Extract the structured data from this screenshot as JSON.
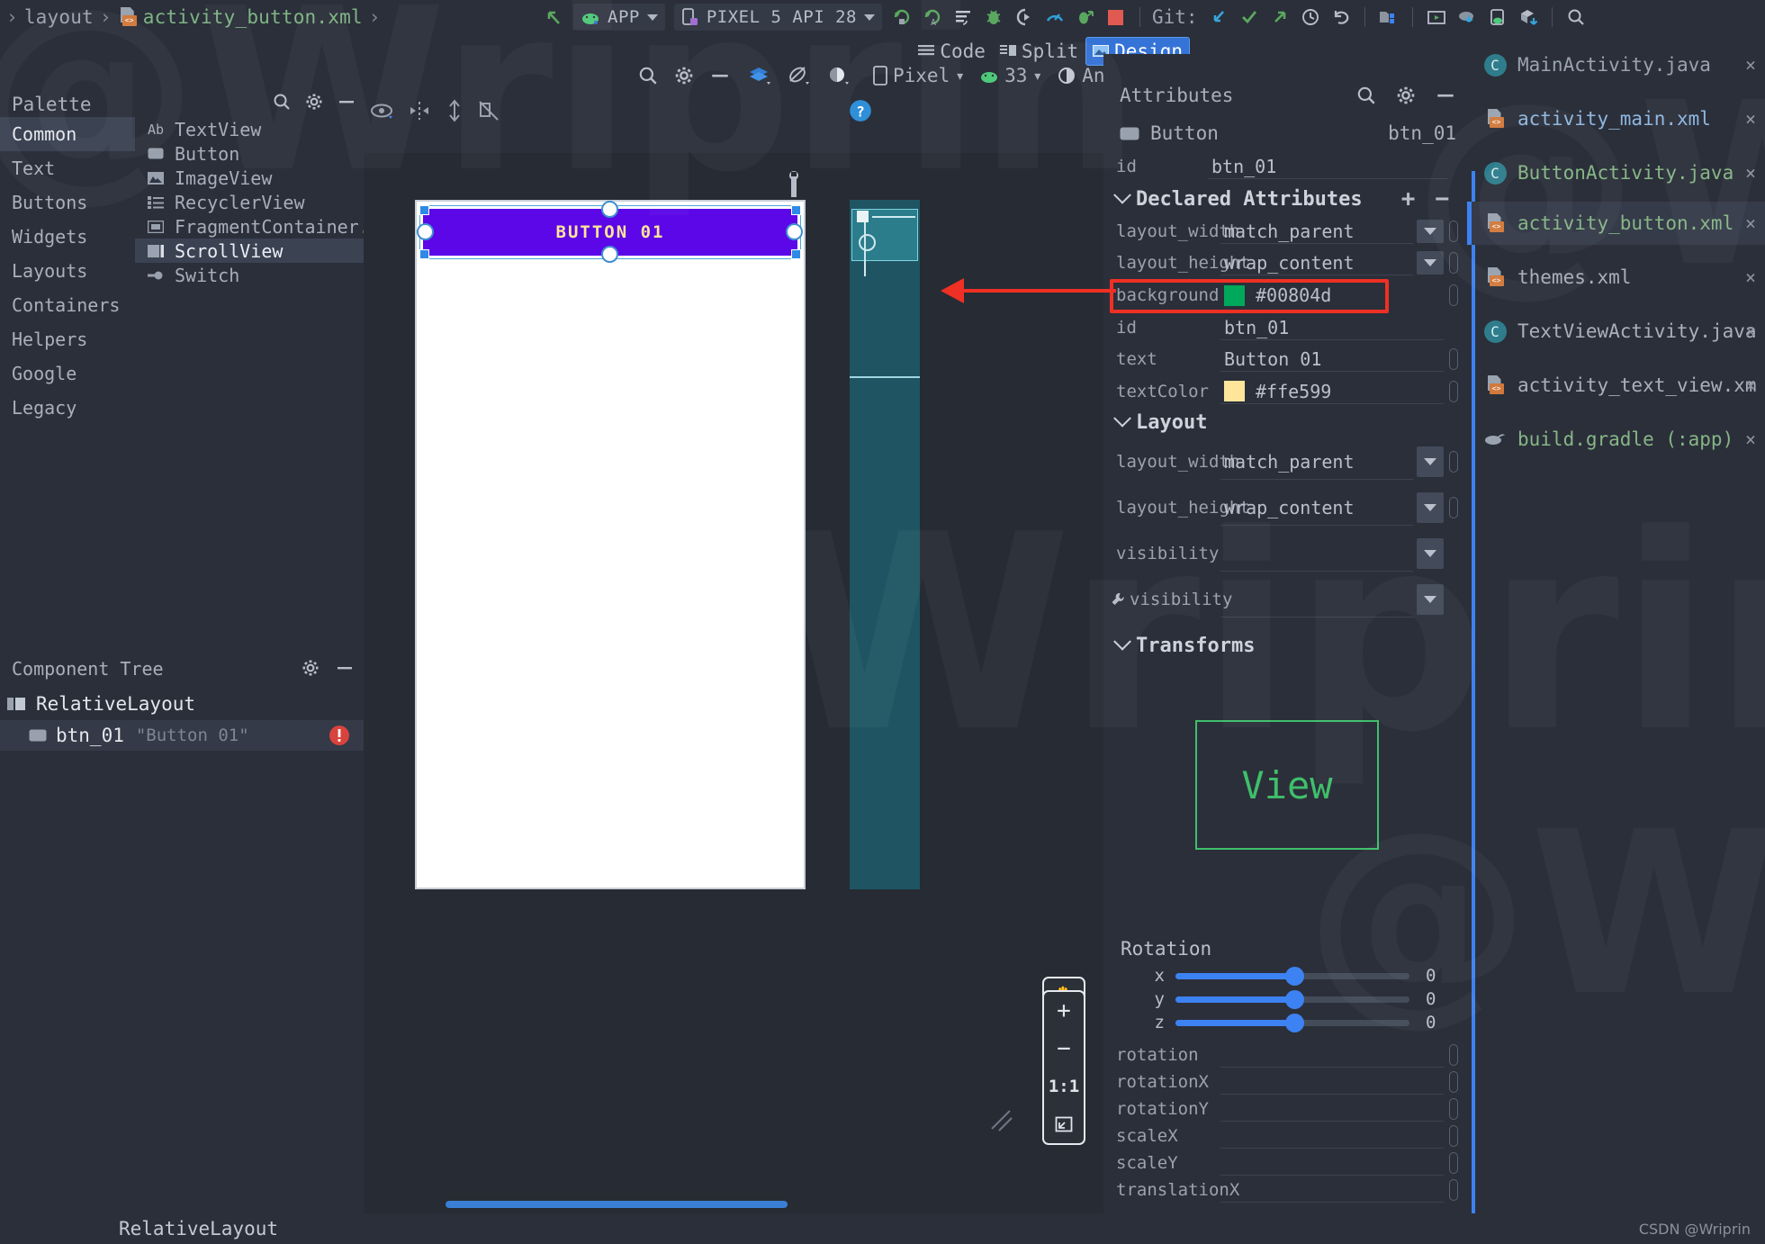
{
  "breadcrumb": {
    "sep": "›",
    "items": [
      {
        "label": "layout",
        "type": "folder"
      },
      {
        "label": "activity_button.xml",
        "type": "xml"
      }
    ]
  },
  "toolbar": {
    "back_icon": "arrow-back-icon",
    "module_selector": {
      "label": "APP",
      "icon": "android-icon"
    },
    "device_selector": {
      "label": "PIXEL 5 API 28",
      "icon": "device-icon"
    },
    "icons": [
      "run-icon",
      "apply-changes-icon",
      "apply-code-changes-icon",
      "run-with-coverage-icon",
      "debug-icon",
      "profile-icon",
      "stop-icon"
    ],
    "git_label": "Git:",
    "git_icons": [
      "update-project-icon",
      "commit-icon",
      "push-icon",
      "history-icon",
      "undo-icon"
    ],
    "right_icons": [
      "project-structure-icon",
      "avd-manager-icon",
      "sdk-manager-icon",
      "device-manager-icon",
      "build-icon",
      "search-icon"
    ]
  },
  "mode_bar": {
    "modes": [
      {
        "label": "Code",
        "icon": "code-icon",
        "active": false
      },
      {
        "label": "Split",
        "icon": "split-icon",
        "active": false
      },
      {
        "label": "Design",
        "icon": "design-icon",
        "active": true
      }
    ]
  },
  "palette": {
    "title": "Palette",
    "header_icons": [
      "search-icon",
      "gear-icon",
      "minimize-icon"
    ],
    "categories": [
      {
        "label": "Common",
        "selected": true
      },
      {
        "label": "Text",
        "selected": false
      },
      {
        "label": "Buttons",
        "selected": false
      },
      {
        "label": "Widgets",
        "selected": false
      },
      {
        "label": "Layouts",
        "selected": false
      },
      {
        "label": "Containers",
        "selected": false
      },
      {
        "label": "Helpers",
        "selected": false
      },
      {
        "label": "Google",
        "selected": false
      },
      {
        "label": "Legacy",
        "selected": false
      }
    ],
    "items": [
      {
        "label": "TextView",
        "icon": "ab-text-icon",
        "selected": false
      },
      {
        "label": "Button",
        "icon": "button-icon",
        "selected": false
      },
      {
        "label": "ImageView",
        "icon": "image-icon",
        "selected": false
      },
      {
        "label": "RecyclerView",
        "icon": "list-icon",
        "selected": false
      },
      {
        "label": "FragmentContainer...",
        "icon": "fragment-icon",
        "selected": false
      },
      {
        "label": "ScrollView",
        "icon": "scrollview-icon",
        "selected": true
      },
      {
        "label": "Switch",
        "icon": "switch-icon",
        "selected": false
      }
    ]
  },
  "component_tree": {
    "title": "Component Tree",
    "header_icons": [
      "gear-icon",
      "minimize-icon"
    ],
    "rows": [
      {
        "name": "RelativeLayout",
        "value": "",
        "icon": "relativelayout-icon",
        "selected": false,
        "error": false
      },
      {
        "name": "btn_01",
        "value": "\"Button 01\"",
        "icon": "button-icon",
        "selected": true,
        "error": true
      }
    ]
  },
  "design_toolbar": {
    "left_icons": [
      "search-icon",
      "gear-icon",
      "minimize-icon"
    ],
    "view_mode_icon": "design-surface-icon",
    "orientation_icon": "rotate-icon",
    "theme_icon": "night-mode-icon",
    "device": {
      "label": "Pixel",
      "icon": "phone-icon"
    },
    "api": {
      "label": "33",
      "icon": "android-icon"
    },
    "theme": {
      "label": "AndroidWalkthrough",
      "icon": "theme-icon"
    },
    "overflow": "»",
    "error_badge": "!",
    "help_badge": "?",
    "row2_icons": [
      "eye-icon",
      "align-horizontal-icon",
      "expand-vertical-icon",
      "no-constraints-icon"
    ]
  },
  "canvas": {
    "button_text": "BUTTON 01",
    "button_background": "#5c07e8",
    "button_text_color": "#ffe599",
    "wrench_icon": "wrench-icon",
    "zoom_controls": {
      "pan_icon": "pan-hand-icon",
      "zoom_in": "+",
      "zoom_out": "−",
      "zoom_actual": "1:1",
      "zoom_fit": "fit-screen-icon"
    }
  },
  "attributes": {
    "title": "Attributes",
    "header_icons": [
      "search-icon",
      "gear-icon",
      "minimize-icon"
    ],
    "selected_component": "Button",
    "selected_id": "btn_01",
    "id_row": {
      "key": "id",
      "value": "btn_01"
    },
    "sections": [
      {
        "title": "Declared Attributes",
        "has_add_remove": true,
        "add_label": "+",
        "remove_label": "−",
        "rows": [
          {
            "key": "layout_width",
            "value": "match_parent",
            "dropdown": true
          },
          {
            "key": "layout_height",
            "value": "wrap_content",
            "dropdown": true
          },
          {
            "key": "background",
            "value": "#00804d",
            "swatch": "#00a85c",
            "highlighted": true
          },
          {
            "key": "id",
            "value": "btn_01"
          },
          {
            "key": "text",
            "value": "Button 01"
          },
          {
            "key": "textColor",
            "value": "#ffe599",
            "swatch": "#ffe599"
          }
        ]
      },
      {
        "title": "Layout",
        "has_add_remove": false,
        "rows": [
          {
            "key": "layout_width",
            "value": "match_parent",
            "dropdown": true
          },
          {
            "key": "layout_height",
            "value": "wrap_content",
            "dropdown": true
          },
          {
            "key": "visibility",
            "value": "",
            "dropdown": true
          },
          {
            "key": "visibility",
            "value": "",
            "dropdown": true,
            "wrench": true
          }
        ]
      },
      {
        "title": "Transforms",
        "has_add_remove": false,
        "rows": []
      }
    ],
    "view_preview_label": "View",
    "view_preview_color": "#3fbf6a",
    "rotation": {
      "title": "Rotation",
      "axes": [
        {
          "label": "x",
          "value": "0"
        },
        {
          "label": "y",
          "value": "0"
        },
        {
          "label": "z",
          "value": "0"
        }
      ]
    },
    "transform_rows": [
      {
        "key": "rotation",
        "value": ""
      },
      {
        "key": "rotationX",
        "value": ""
      },
      {
        "key": "rotationY",
        "value": ""
      },
      {
        "key": "scaleX",
        "value": ""
      },
      {
        "key": "scaleY",
        "value": ""
      },
      {
        "key": "translationX",
        "value": ""
      }
    ]
  },
  "files": [
    {
      "name": "MainActivity.java",
      "icon": "java-class-icon",
      "style": "java",
      "selected": false
    },
    {
      "name": "activity_main.xml",
      "icon": "xml-layout-icon",
      "style": "xml",
      "selected": false
    },
    {
      "name": "ButtonActivity.java",
      "icon": "java-class-icon",
      "style": "green",
      "selected": false
    },
    {
      "name": "activity_button.xml",
      "icon": "xml-layout-icon",
      "style": "green",
      "selected": true
    },
    {
      "name": "themes.xml",
      "icon": "xml-layout-icon",
      "style": "grey",
      "selected": false
    },
    {
      "name": "TextViewActivity.java",
      "icon": "java-class-icon",
      "style": "grey",
      "selected": false
    },
    {
      "name": "activity_text_view.xm",
      "icon": "xml-layout-icon",
      "style": "grey",
      "selected": false
    },
    {
      "name": "build.gradle (:app)",
      "icon": "gradle-icon",
      "style": "green",
      "selected": false
    }
  ],
  "status_bar": {
    "text": "RelativeLayout",
    "credit": "CSDN @Wriprin"
  },
  "watermark": {
    "text": "@Wriprin"
  }
}
